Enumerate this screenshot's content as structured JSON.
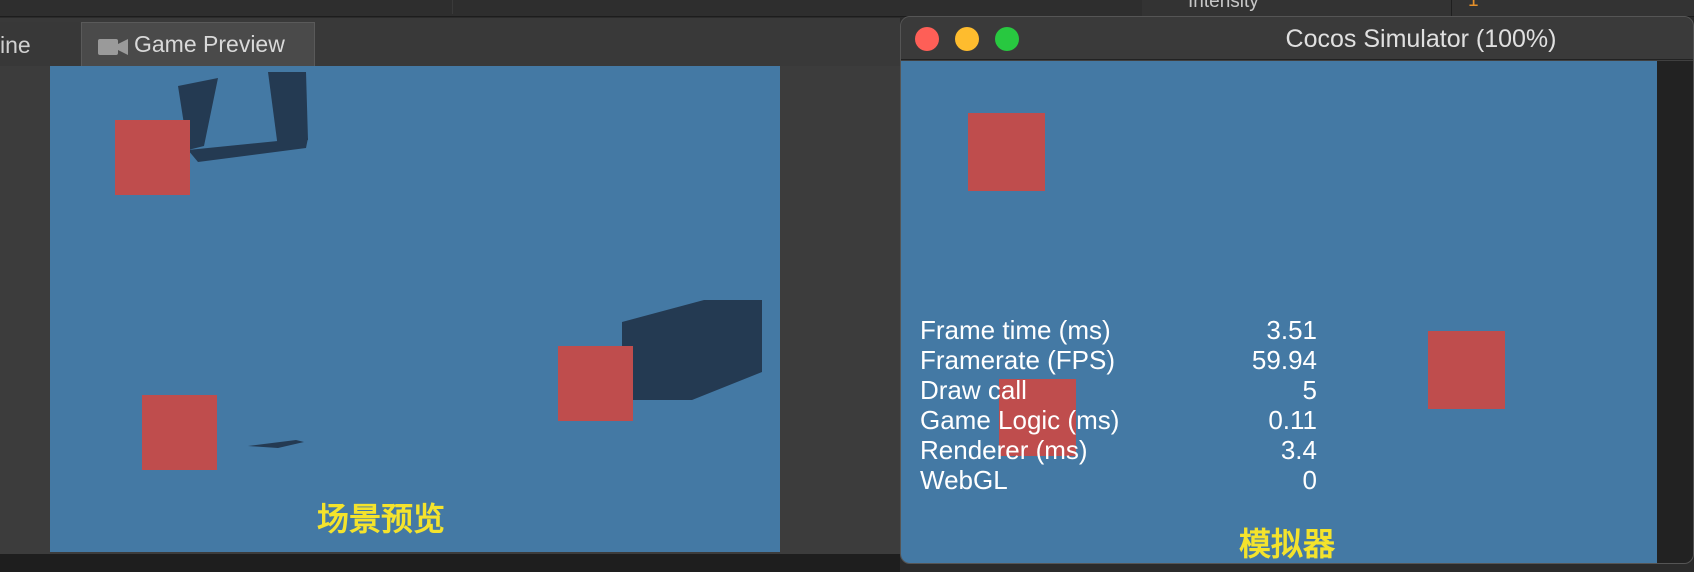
{
  "editor": {
    "top_inspector_label": "Intensity",
    "top_inspector_value": "1",
    "tabs": [
      {
        "label": "ine"
      },
      {
        "label": "Game Preview",
        "icon": "camera-icon"
      }
    ],
    "preview_caption": "场景预览"
  },
  "simulator": {
    "title": "Cocos Simulator (100%)",
    "window_buttons": {
      "close": "#fe5f57",
      "minimize": "#febc2e",
      "maximize": "#28c840"
    },
    "stats": [
      {
        "label": "Frame time (ms)",
        "value": "3.51"
      },
      {
        "label": "Framerate (FPS)",
        "value": "59.94"
      },
      {
        "label": "Draw call",
        "value": "5"
      },
      {
        "label": "Game Logic (ms)",
        "value": "0.11"
      },
      {
        "label": "Renderer (ms)",
        "value": "3.4"
      },
      {
        "label": "WebGL",
        "value": "0"
      }
    ],
    "caption": "模拟器"
  },
  "colors": {
    "scene_background": "#4479a4",
    "cube": "#bf4d4d",
    "shadow": "#243a52",
    "caption": "#f4e32c"
  }
}
